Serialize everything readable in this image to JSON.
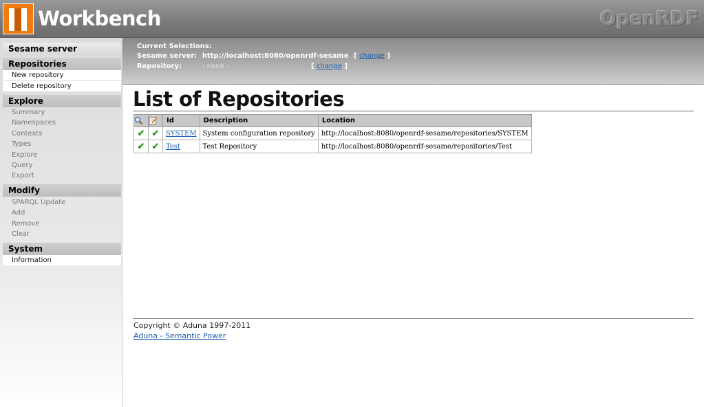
{
  "header": {
    "app_title": "Workbench",
    "brand": "OpenRDF"
  },
  "selections": {
    "heading": "Current Selections:",
    "server_label": "Sesame server:",
    "server_value": "http://localhost:8080/openrdf-sesame",
    "repo_label": "Repository:",
    "repo_value": "- none -",
    "change_label": "change",
    "bracket_open": "[",
    "bracket_close": "]"
  },
  "sidebar": {
    "sesame_server": "Sesame server",
    "repositories": "Repositories",
    "new_repository": "New repository",
    "delete_repository": "Delete repository",
    "explore": "Explore",
    "summary": "Summary",
    "namespaces": "Namespaces",
    "contexts": "Contexts",
    "types": "Types",
    "explore_item": "Explore",
    "query": "Query",
    "export": "Export",
    "modify": "Modify",
    "sparql_update": "SPARQL Update",
    "add": "Add",
    "remove": "Remove",
    "clear": "Clear",
    "system": "System",
    "information": "Information"
  },
  "main": {
    "page_title": "List of Repositories",
    "table": {
      "col_id": "Id",
      "col_description": "Description",
      "col_location": "Location",
      "rows": [
        {
          "id": "SYSTEM",
          "description": "System configuration repository",
          "location": "http://localhost:8080/openrdf-sesame/repositories/SYSTEM"
        },
        {
          "id": "Test",
          "description": "Test Repository",
          "location": "http://localhost:8080/openrdf-sesame/repositories/Test"
        }
      ]
    }
  },
  "footer": {
    "copyright": "Copyright © Aduna 1997-2011",
    "link": "Aduna - Semantic Power"
  },
  "icons": {
    "check": "✔",
    "search": "search-icon",
    "edit": "edit-icon"
  }
}
